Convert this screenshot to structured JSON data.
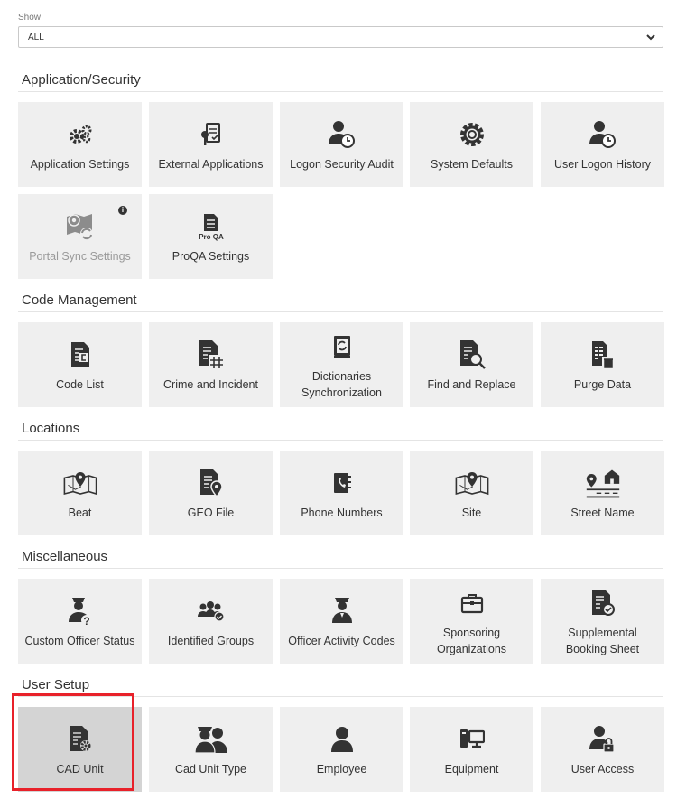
{
  "filter": {
    "label": "Show",
    "value": "ALL"
  },
  "sections": [
    {
      "title": "Application/Security",
      "tiles": [
        "Application Settings",
        "External Applications",
        "Logon Security Audit",
        "System Defaults",
        "User Logon History",
        "Portal Sync Settings",
        "ProQA Settings"
      ]
    },
    {
      "title": "Code Management",
      "tiles": [
        "Code List",
        "Crime and Incident",
        "Dictionaries Synchronization",
        "Find and Replace",
        "Purge Data"
      ]
    },
    {
      "title": "Locations",
      "tiles": [
        "Beat",
        "GEO File",
        "Phone Numbers",
        "Site",
        "Street Name"
      ]
    },
    {
      "title": "Miscellaneous",
      "tiles": [
        "Custom Officer Status",
        "Identified Groups",
        "Officer Activity Codes",
        "Sponsoring Organizations",
        "Supplemental Booking Sheet"
      ]
    },
    {
      "title": "User Setup",
      "tiles": [
        "CAD Unit",
        "Cad Unit Type",
        "Employee",
        "Equipment",
        "User Access"
      ]
    }
  ],
  "proqa_icon_text": "Pro QA",
  "info_icon_text": "i",
  "colors": {
    "tile_bg": "#efefef",
    "selected_bg": "#d4d4d4",
    "icon": "#333333",
    "highlight": "#e8212a"
  }
}
